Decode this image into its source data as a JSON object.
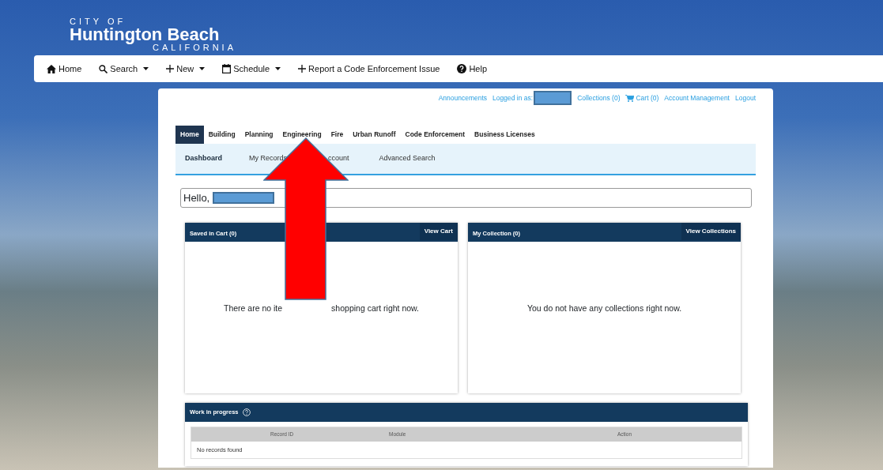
{
  "logo": {
    "line_1": "CITY OF",
    "line_2": "Huntington Beach",
    "line_3": "CALIFORNIA"
  },
  "main_nav": [
    {
      "label": "Home",
      "caret": false
    },
    {
      "label": "Search",
      "caret": true
    },
    {
      "label": "New",
      "caret": true
    },
    {
      "label": "Schedule",
      "caret": true
    },
    {
      "label": "Report a Code Enforcement Issue",
      "caret": false
    },
    {
      "label": "Help",
      "caret": false
    }
  ],
  "top_links": [
    {
      "kind": "link",
      "label": "Announcements"
    },
    {
      "kind": "user",
      "label": "Logged in as:"
    },
    {
      "kind": "link",
      "label": "Collections (0)"
    },
    {
      "kind": "cart",
      "label": "Cart (0)"
    },
    {
      "kind": "link",
      "label": "Account Management"
    },
    {
      "kind": "link",
      "label": "Logout"
    }
  ],
  "module_tabs": [
    {
      "label": "Home",
      "selected": true
    },
    {
      "label": "Building",
      "selected": false
    },
    {
      "label": "Planning",
      "selected": false
    },
    {
      "label": "Engineering",
      "selected": false
    },
    {
      "label": "Fire",
      "selected": false
    },
    {
      "label": "Urban Runoff",
      "selected": false
    },
    {
      "label": "Code Enforcement",
      "selected": false
    },
    {
      "label": "Business Licenses",
      "selected": false
    }
  ],
  "sub_tabs": [
    {
      "label": "Dashboard",
      "selected": true
    },
    {
      "label": "My Records",
      "selected": false
    },
    {
      "label": "ccount",
      "selected": false
    },
    {
      "label": "Advanced Search",
      "selected": false
    }
  ],
  "greeting": "Hello,",
  "cart_panel": {
    "title": "Saved in Cart (0)",
    "button": "View Cart",
    "message_parts": [
      "There are no ite",
      "shopping cart right now."
    ]
  },
  "collection_panel": {
    "title": "My Collection (0)",
    "button": "View Collections",
    "message": "You do not have any collections right now."
  },
  "work_in_progress": {
    "title": "Work in progress",
    "columns": [
      "Record ID",
      "Module",
      "Action"
    ],
    "empty_message": "No records found"
  }
}
